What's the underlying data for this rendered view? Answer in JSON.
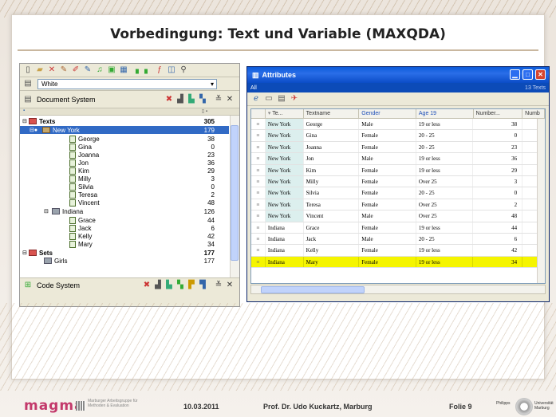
{
  "slide": {
    "title": "Vorbedingung: Text und Variable (MAXQDA)",
    "footer": {
      "logo": "magma",
      "logo_sub": "Marburger Arbeitsgruppe für Methoden & Evaluation",
      "date": "10.03.2011",
      "author": "Prof. Dr. Udo Kuckartz, Marburg",
      "slide_no": "Folie 9",
      "uni_left": "Philipps",
      "uni_right": "Universität Marburg"
    }
  },
  "maxqda": {
    "color_value": "White",
    "document_system": {
      "title": "Document System",
      "root": {
        "label": "Texts",
        "count": "305"
      },
      "groups": [
        {
          "label": "New York",
          "count": "179",
          "docs": [
            {
              "label": "George",
              "count": "38"
            },
            {
              "label": "Gina",
              "count": "0"
            },
            {
              "label": "Joanna",
              "count": "23"
            },
            {
              "label": "Jon",
              "count": "36"
            },
            {
              "label": "Kim",
              "count": "29"
            },
            {
              "label": "Milly",
              "count": "3"
            },
            {
              "label": "Silvia",
              "count": "0"
            },
            {
              "label": "Teresa",
              "count": "2"
            },
            {
              "label": "Vincent",
              "count": "48"
            }
          ]
        },
        {
          "label": "Indiana",
          "count": "126",
          "docs": [
            {
              "label": "Grace",
              "count": "44"
            },
            {
              "label": "Jack",
              "count": "6"
            },
            {
              "label": "Kelly",
              "count": "42"
            },
            {
              "label": "Mary",
              "count": "34"
            }
          ]
        }
      ],
      "sets": {
        "label": "Sets",
        "count": "177"
      },
      "sets_child": {
        "label": "Girls",
        "count": "177"
      }
    },
    "code_system": {
      "title": "Code System"
    }
  },
  "attributes": {
    "title": "Attributes",
    "filter": "All",
    "count_label": "13 Texts",
    "columns": [
      "Te...",
      "Textname",
      "Gender",
      "Age 19",
      "Number...",
      "Numb"
    ],
    "rows": [
      {
        "group": "New York",
        "name": "George",
        "gender": "Male",
        "age": "19 or less",
        "number": "38"
      },
      {
        "group": "New York",
        "name": "Gina",
        "gender": "Female",
        "age": "20 - 25",
        "number": "0"
      },
      {
        "group": "New York",
        "name": "Joanna",
        "gender": "Female",
        "age": "20 - 25",
        "number": "23"
      },
      {
        "group": "New York",
        "name": "Jon",
        "gender": "Male",
        "age": "19 or less",
        "number": "36"
      },
      {
        "group": "New York",
        "name": "Kim",
        "gender": "Female",
        "age": "19 or less",
        "number": "29"
      },
      {
        "group": "New York",
        "name": "Milly",
        "gender": "Female",
        "age": "Over 25",
        "number": "3"
      },
      {
        "group": "New York",
        "name": "Silvia",
        "gender": "Female",
        "age": "20 - 25",
        "number": "0"
      },
      {
        "group": "New York",
        "name": "Teresa",
        "gender": "Female",
        "age": "Over 25",
        "number": "2"
      },
      {
        "group": "New York",
        "name": "Vincent",
        "gender": "Male",
        "age": "Over 25",
        "number": "48"
      },
      {
        "group": "Indiana",
        "name": "Grace",
        "gender": "Female",
        "age": "19 or less",
        "number": "44"
      },
      {
        "group": "Indiana",
        "name": "Jack",
        "gender": "Male",
        "age": "20 - 25",
        "number": "6"
      },
      {
        "group": "Indiana",
        "name": "Kelly",
        "gender": "Female",
        "age": "19 or less",
        "number": "42"
      },
      {
        "group": "Indiana",
        "name": "Mary",
        "gender": "Female",
        "age": "19 or less",
        "number": "34"
      }
    ],
    "selected_row": 12
  }
}
